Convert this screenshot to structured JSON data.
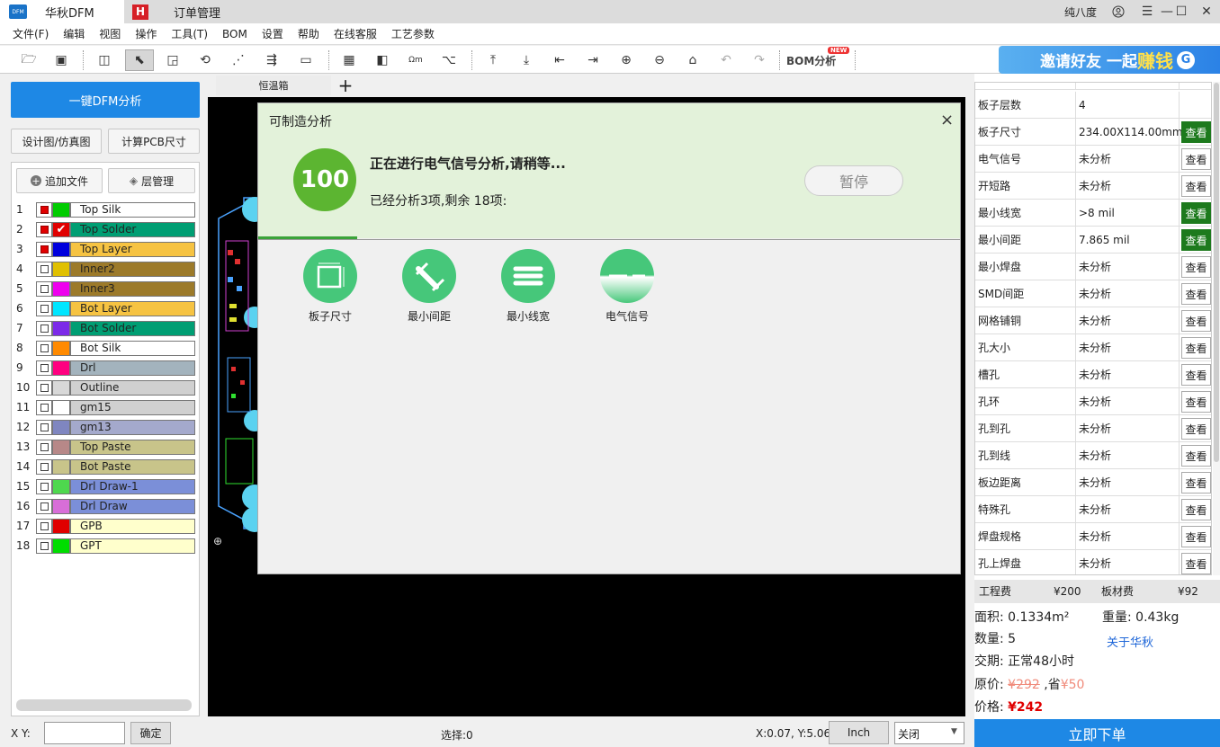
{
  "titlebar": {
    "app_tab": "华秋DFM",
    "app_logo": "DFM",
    "order_logo": "H",
    "order_tab": "订单管理",
    "user": "纯八度"
  },
  "menu": [
    "文件(F)",
    "编辑",
    "视图",
    "操作",
    "工具(T)",
    "BOM",
    "设置",
    "帮助",
    "在线客服",
    "工艺参数"
  ],
  "toolbar": {
    "bom_label": "BOM分析",
    "bom_badge": "NEW",
    "banner_a": "邀请好友",
    "banner_b": "一起",
    "banner_c": "赚钱",
    "banner_d": "G"
  },
  "left": {
    "dfm_button": "一键DFM分析",
    "design_button": "设计图/仿真图",
    "calc_button": "计算PCB尺寸",
    "add_file": "追加文件",
    "layer_mgr": "层管理"
  },
  "layers": [
    {
      "n": "1",
      "name": "Top Silk",
      "color": "#00cc00",
      "bg": "#ffffff",
      "on": true,
      "check": false
    },
    {
      "n": "2",
      "name": "Top Solder",
      "color": "#e00000",
      "bg": "#009e73",
      "on": true,
      "check": true
    },
    {
      "n": "3",
      "name": "Top Layer",
      "color": "#0000dd",
      "bg": "#f6c342",
      "on": true,
      "check": false
    },
    {
      "n": "4",
      "name": "Inner2",
      "color": "#e0c000",
      "bg": "#9c7a2a",
      "on": false,
      "check": false
    },
    {
      "n": "5",
      "name": "Inner3",
      "color": "#ee00ee",
      "bg": "#9c7a2a",
      "on": false,
      "check": false
    },
    {
      "n": "6",
      "name": "Bot Layer",
      "color": "#00e6ff",
      "bg": "#f6c342",
      "on": false,
      "check": false
    },
    {
      "n": "7",
      "name": "Bot Solder",
      "color": "#7c2ae8",
      "bg": "#009e73",
      "on": false,
      "check": false
    },
    {
      "n": "8",
      "name": "Bot Silk",
      "color": "#ff8a00",
      "bg": "#ffffff",
      "on": false,
      "check": false
    },
    {
      "n": "9",
      "name": "Drl",
      "color": "#ff0080",
      "bg": "#a3b3bd",
      "on": false,
      "check": false
    },
    {
      "n": "10",
      "name": "Outline",
      "color": "#d8d8d8",
      "bg": "#d0d0d0",
      "on": false,
      "check": false
    },
    {
      "n": "11",
      "name": "gm15",
      "color": "#ffffff",
      "bg": "#d0d0d0",
      "on": false,
      "check": false
    },
    {
      "n": "12",
      "name": "gm13",
      "color": "#7f86c0",
      "bg": "#a4a9cc",
      "on": false,
      "check": false
    },
    {
      "n": "13",
      "name": "Top Paste",
      "color": "#b78888",
      "bg": "#c8c48a",
      "on": false,
      "check": false
    },
    {
      "n": "14",
      "name": "Bot Paste",
      "color": "#c8c48a",
      "bg": "#c8c48a",
      "on": false,
      "check": false
    },
    {
      "n": "15",
      "name": "Drl Draw-1",
      "color": "#4ed84e",
      "bg": "#7b8fd8",
      "on": false,
      "check": false
    },
    {
      "n": "16",
      "name": "Drl Draw",
      "color": "#d86ed8",
      "bg": "#7b8fd8",
      "on": false,
      "check": false
    },
    {
      "n": "17",
      "name": "GPB",
      "color": "#e00000",
      "bg": "#ffffcc",
      "on": false,
      "check": false
    },
    {
      "n": "18",
      "name": "GPT",
      "color": "#00dd00",
      "bg": "#ffffcc",
      "on": false,
      "check": false
    }
  ],
  "canvas": {
    "tab": "恒温箱",
    "plus": "+"
  },
  "dialog": {
    "title": "可制造分析",
    "close": "×",
    "score": "100",
    "status": "正在进行电气信号分析,请稍等...",
    "progress": "已经分析3项,剩余 18项:",
    "pause": "暂停",
    "categories": [
      "板子尺寸",
      "最小间距",
      "最小线宽",
      "电气信号"
    ]
  },
  "analysis": [
    {
      "label": "板子层数",
      "value": "4",
      "btn": ""
    },
    {
      "label": "板子尺寸",
      "value": "234.00X114.00mm",
      "btn": "查看",
      "green": true
    },
    {
      "label": "电气信号",
      "value": "未分析",
      "btn": "查看"
    },
    {
      "label": "开短路",
      "value": "未分析",
      "btn": "查看"
    },
    {
      "label": "最小线宽",
      "value": ">8 mil",
      "btn": "查看",
      "green": true
    },
    {
      "label": "最小间距",
      "value": "7.865 mil",
      "btn": "查看",
      "green": true
    },
    {
      "label": "最小焊盘",
      "value": "未分析",
      "btn": "查看"
    },
    {
      "label": "SMD间距",
      "value": "未分析",
      "btn": "查看"
    },
    {
      "label": "网格铺铜",
      "value": "未分析",
      "btn": "查看"
    },
    {
      "label": "孔大小",
      "value": "未分析",
      "btn": "查看"
    },
    {
      "label": "槽孔",
      "value": "未分析",
      "btn": "查看"
    },
    {
      "label": "孔环",
      "value": "未分析",
      "btn": "查看"
    },
    {
      "label": "孔到孔",
      "value": "未分析",
      "btn": "查看"
    },
    {
      "label": "孔到线",
      "value": "未分析",
      "btn": "查看"
    },
    {
      "label": "板边距离",
      "value": "未分析",
      "btn": "查看"
    },
    {
      "label": "特殊孔",
      "value": "未分析",
      "btn": "查看"
    },
    {
      "label": "焊盘规格",
      "value": "未分析",
      "btn": "查看"
    },
    {
      "label": "孔上焊盘",
      "value": "未分析",
      "btn": "查看"
    }
  ],
  "costs": {
    "eng_label": "工程费",
    "eng": "¥200",
    "board_label": "板材费",
    "board": "¥92"
  },
  "info": {
    "area_label": "面积:",
    "area": "0.1334m²",
    "weight_label": "重量:",
    "weight": "0.43kg",
    "qty_label": "数量:",
    "qty": "5",
    "about": "关于华秋",
    "delivery_label": "交期:",
    "delivery": "正常48小时",
    "orig_label": "原价:",
    "orig": "¥292",
    "save_label": ",省",
    "save": "¥50",
    "price_label": "价格:",
    "price": "¥242"
  },
  "order_button": "立即下单",
  "statusbar": {
    "xy_label": "X Y:",
    "ok": "确定",
    "select": "选择:0",
    "coords": "X:0.07, Y:5.06",
    "unit": "Inch",
    "dropdown": "关闭"
  }
}
